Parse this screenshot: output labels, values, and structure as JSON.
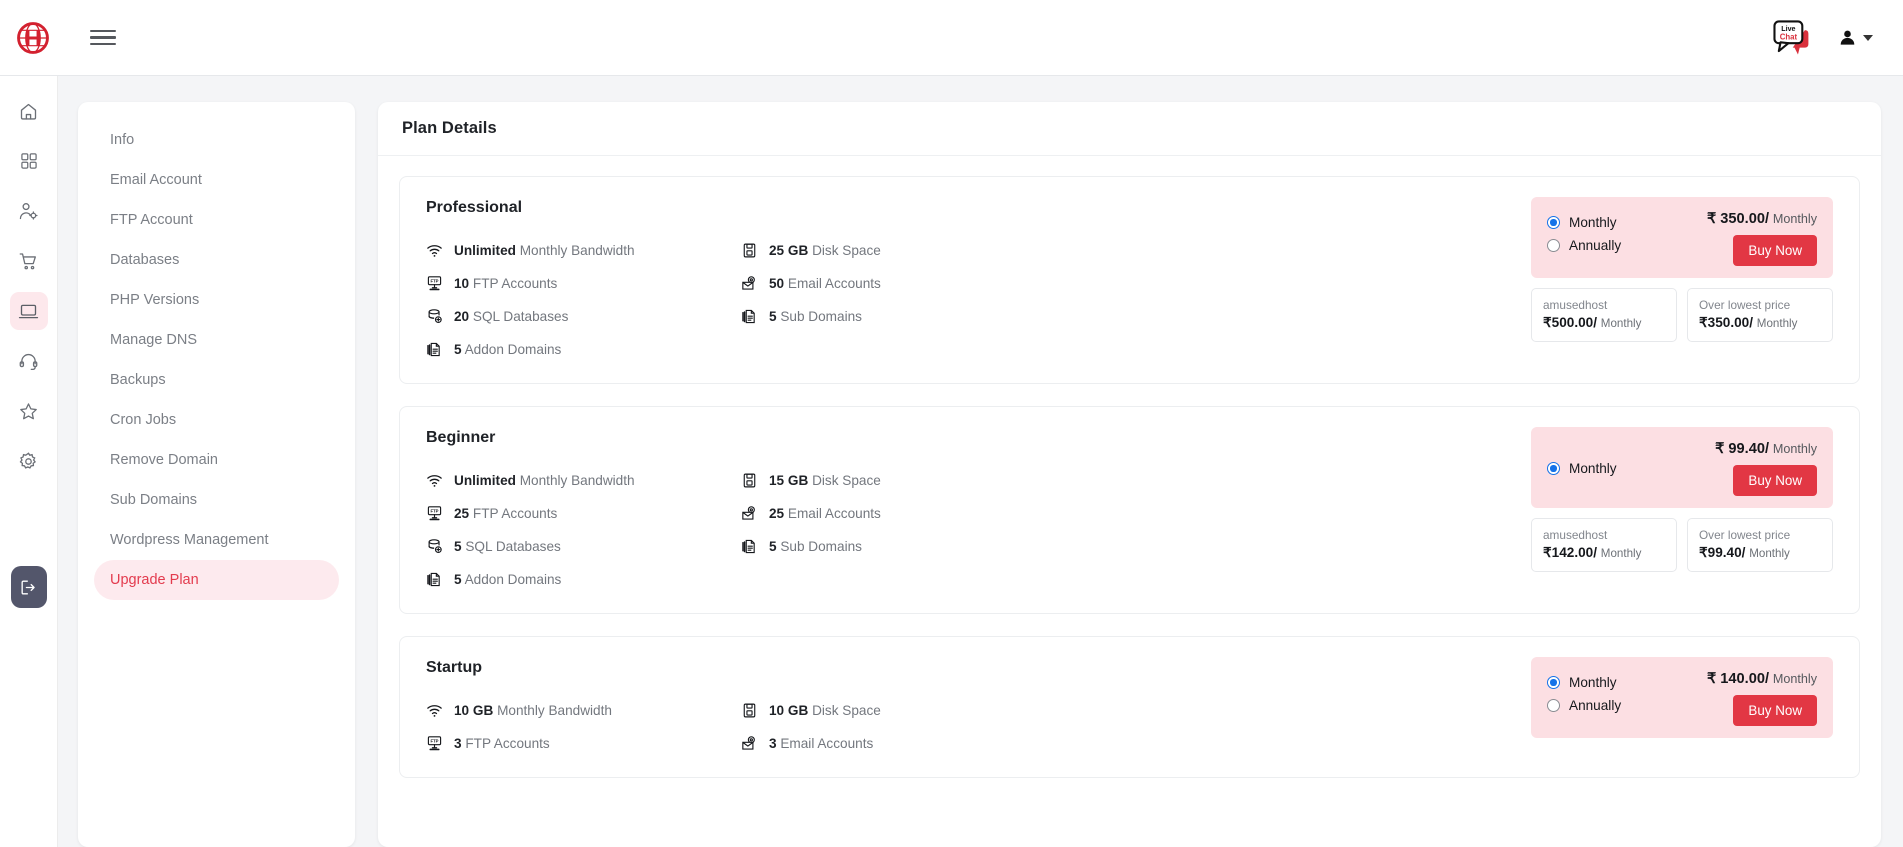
{
  "topbar": {
    "logo_icon": "globe-h-logo",
    "menu_icon": "hamburger-menu-icon",
    "livechat_label_top": "Live",
    "livechat_label_bottom": "Chat",
    "user_icon": "user-avatar-icon"
  },
  "rail": {
    "items": [
      {
        "icon": "home-icon",
        "active": false
      },
      {
        "icon": "grid-apps-icon",
        "active": false
      },
      {
        "icon": "user-settings-icon",
        "active": false
      },
      {
        "icon": "shopping-cart-icon",
        "active": false
      },
      {
        "icon": "laptop-icon",
        "active": true
      },
      {
        "icon": "headset-support-icon",
        "active": false
      },
      {
        "icon": "star-icon",
        "active": false
      },
      {
        "icon": "gear-settings-icon",
        "active": false
      }
    ],
    "logout_icon": "logout-icon"
  },
  "sidebar": {
    "items": [
      {
        "label": "Info",
        "active": false
      },
      {
        "label": "Email Account",
        "active": false
      },
      {
        "label": "FTP Account",
        "active": false
      },
      {
        "label": "Databases",
        "active": false
      },
      {
        "label": "PHP Versions",
        "active": false
      },
      {
        "label": "Manage DNS",
        "active": false
      },
      {
        "label": "Backups",
        "active": false
      },
      {
        "label": "Cron Jobs",
        "active": false
      },
      {
        "label": "Remove Domain",
        "active": false
      },
      {
        "label": "Sub Domains",
        "active": false
      },
      {
        "label": "Wordpress Management",
        "active": false
      },
      {
        "label": "Upgrade Plan",
        "active": true
      }
    ]
  },
  "main": {
    "title": "Plan Details",
    "buy_label": "Buy Now",
    "plans": [
      {
        "name": "Professional",
        "features_left": [
          {
            "icon": "wifi-icon",
            "value": "Unlimited",
            "label": "Monthly Bandwidth"
          },
          {
            "icon": "ftp-server-icon",
            "value": "10",
            "label": "FTP Accounts"
          },
          {
            "icon": "database-icon",
            "value": "20",
            "label": "SQL Databases"
          },
          {
            "icon": "documents-icon",
            "value": "5",
            "label": "Addon Domains"
          }
        ],
        "features_right": [
          {
            "icon": "disk-icon",
            "value": "25 GB",
            "label": "Disk Space"
          },
          {
            "icon": "email-icon",
            "value": "50",
            "label": "Email Accounts"
          },
          {
            "icon": "documents-icon",
            "value": "5",
            "label": "Sub Domains"
          }
        ],
        "cycles": [
          {
            "label": "Monthly",
            "selected": true
          },
          {
            "label": "Annually",
            "selected": false
          }
        ],
        "price_amount": "₹ 350.00/",
        "price_period": "Monthly",
        "compare": [
          {
            "label": "amusedhost",
            "amount": "₹500.00/",
            "period": "Monthly"
          },
          {
            "label": "Over lowest price",
            "amount": "₹350.00/",
            "period": "Monthly"
          }
        ]
      },
      {
        "name": "Beginner",
        "features_left": [
          {
            "icon": "wifi-icon",
            "value": "Unlimited",
            "label": "Monthly Bandwidth"
          },
          {
            "icon": "ftp-server-icon",
            "value": "25",
            "label": "FTP Accounts"
          },
          {
            "icon": "database-icon",
            "value": "5",
            "label": "SQL Databases"
          },
          {
            "icon": "documents-icon",
            "value": "5",
            "label": "Addon Domains"
          }
        ],
        "features_right": [
          {
            "icon": "disk-icon",
            "value": "15 GB",
            "label": "Disk Space"
          },
          {
            "icon": "email-icon",
            "value": "25",
            "label": "Email Accounts"
          },
          {
            "icon": "documents-icon",
            "value": "5",
            "label": "Sub Domains"
          }
        ],
        "cycles": [
          {
            "label": "Monthly",
            "selected": true
          }
        ],
        "price_amount": "₹ 99.40/",
        "price_period": "Monthly",
        "compare": [
          {
            "label": "amusedhost",
            "amount": "₹142.00/",
            "period": "Monthly"
          },
          {
            "label": "Over lowest price",
            "amount": "₹99.40/",
            "period": "Monthly"
          }
        ]
      },
      {
        "name": "Startup",
        "features_left": [
          {
            "icon": "wifi-icon",
            "value": "10 GB",
            "label": "Monthly Bandwidth"
          },
          {
            "icon": "ftp-server-icon",
            "value": "3",
            "label": "FTP Accounts"
          }
        ],
        "features_right": [
          {
            "icon": "disk-icon",
            "value": "10 GB",
            "label": "Disk Space"
          },
          {
            "icon": "email-icon",
            "value": "3",
            "label": "Email Accounts"
          }
        ],
        "cycles": [
          {
            "label": "Monthly",
            "selected": true
          },
          {
            "label": "Annually",
            "selected": false
          }
        ],
        "price_amount": "₹ 140.00/",
        "price_period": "Monthly",
        "compare": []
      }
    ]
  },
  "colors": {
    "brand_red": "#e23744",
    "panel_pink": "#fcdfe3",
    "active_pink": "#fdeaee",
    "radio_blue": "#1572e8"
  }
}
